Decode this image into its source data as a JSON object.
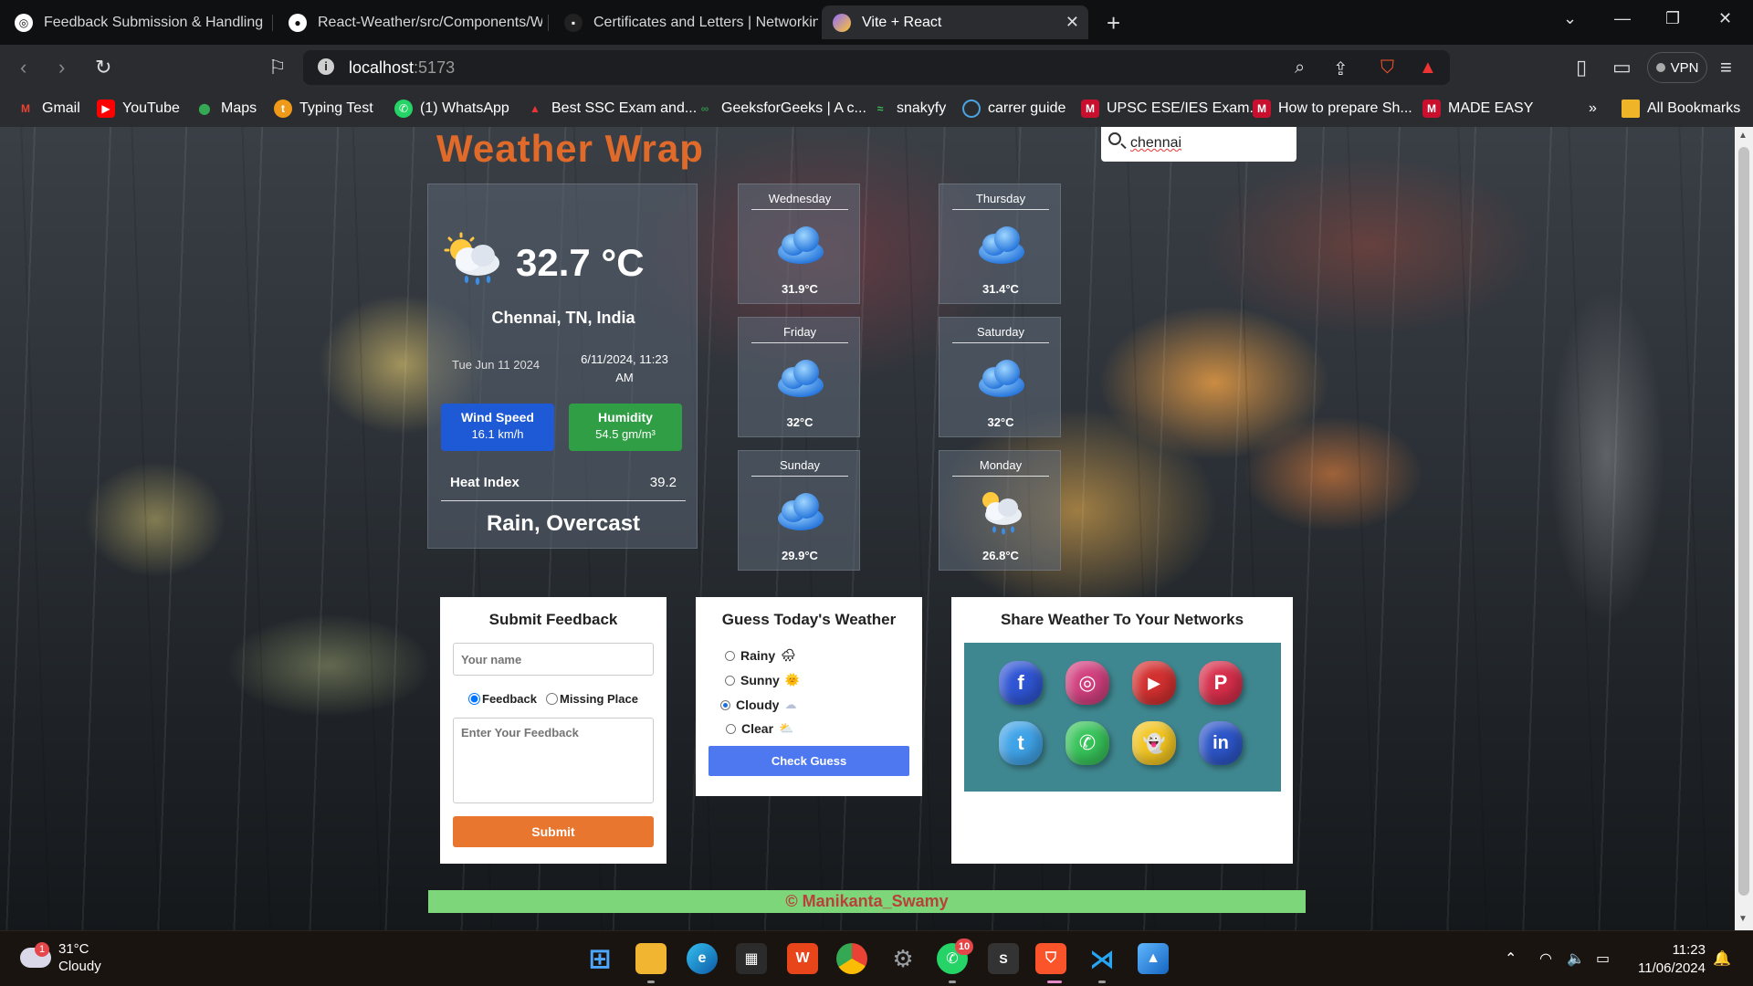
{
  "browser": {
    "tabs": [
      {
        "title": "Feedback Submission & Handling",
        "icon": "page-icon"
      },
      {
        "title": "React-Weather/src/Components/We",
        "icon": "github-icon"
      },
      {
        "title": "Certificates and Letters | Networking",
        "icon": "page-icon"
      },
      {
        "title": "Vite + React",
        "icon": "vite-icon"
      }
    ],
    "url_host": "localhost",
    "url_port": ":5173",
    "vpn_label": "VPN",
    "bookmarks": [
      "Gmail",
      "YouTube",
      "Maps",
      "Typing Test",
      "(1) WhatsApp",
      "Best SSC Exam and...",
      "GeeksforGeeks | A c...",
      "snakyfy",
      "carrer guide",
      "UPSC ESE/IES Exam...",
      "How to prepare Sh...",
      "MADE EASY"
    ],
    "all_bookmarks": "All Bookmarks",
    "more_bookmarks": "»"
  },
  "app": {
    "brand": "Weather Wrap",
    "search_value": "chennai"
  },
  "current": {
    "temperature": "32.7 °C",
    "location": "Chennai, TN, India",
    "day": "Tue Jun 11 2024",
    "datetime_line1": "6/11/2024, 11:23",
    "datetime_line2": "AM",
    "wind_label": "Wind Speed",
    "wind_value": "16.1 km/h",
    "humidity_label": "Humidity",
    "humidity_value": "54.5 gm/m³",
    "heat_label": "Heat Index",
    "heat_value": "39.2",
    "condition": "Rain, Overcast",
    "icon": "sun-cloud-rain-icon"
  },
  "forecast": [
    {
      "day": "Wednesday",
      "temp": "31.9°C",
      "icon": "cloud-icon"
    },
    {
      "day": "Thursday",
      "temp": "31.4°C",
      "icon": "cloud-icon"
    },
    {
      "day": "Friday",
      "temp": "32°C",
      "icon": "cloud-icon"
    },
    {
      "day": "Saturday",
      "temp": "32°C",
      "icon": "cloud-icon"
    },
    {
      "day": "Sunday",
      "temp": "29.9°C",
      "icon": "cloud-icon"
    },
    {
      "day": "Monday",
      "temp": "26.8°C",
      "icon": "sun-cloud-rain-icon"
    }
  ],
  "feedback": {
    "title": "Submit Feedback",
    "name_placeholder": "Your name",
    "radio_feedback": "Feedback",
    "radio_missing": "Missing Place",
    "selected": "Feedback",
    "message_placeholder": "Enter Your Feedback",
    "submit": "Submit"
  },
  "guess": {
    "title": "Guess Today's Weather",
    "options": [
      {
        "label": "Rainy",
        "emoji": "🌧"
      },
      {
        "label": "Sunny",
        "emoji": "🌞"
      },
      {
        "label": "Cloudy",
        "emoji": "☁"
      },
      {
        "label": "Clear",
        "emoji": "⛅"
      }
    ],
    "selected": "Cloudy",
    "button": "Check Guess"
  },
  "share": {
    "title": "Share Weather To Your Networks",
    "networks": [
      {
        "name": "facebook",
        "glyph": "f",
        "color": "#2f55d4"
      },
      {
        "name": "instagram",
        "glyph": "◎",
        "color": "#d1407e"
      },
      {
        "name": "youtube",
        "glyph": "▶",
        "color": "#d33030"
      },
      {
        "name": "pinterest",
        "glyph": "P",
        "color": "#d62e4a"
      },
      {
        "name": "twitter",
        "glyph": "t",
        "color": "#3fa3e8"
      },
      {
        "name": "whatsapp",
        "glyph": "✆",
        "color": "#37c45a"
      },
      {
        "name": "snapchat",
        "glyph": "👻",
        "color": "#f2c521"
      },
      {
        "name": "linkedin",
        "glyph": "in",
        "color": "#2c55c8"
      }
    ]
  },
  "footer": "© Manikanta_Swamy",
  "taskbar": {
    "weather_temp": "31°C",
    "weather_desc": "Cloudy",
    "weather_badge": "1",
    "whatsapp_badge": "10",
    "time": "11:23",
    "date": "11/06/2024"
  }
}
